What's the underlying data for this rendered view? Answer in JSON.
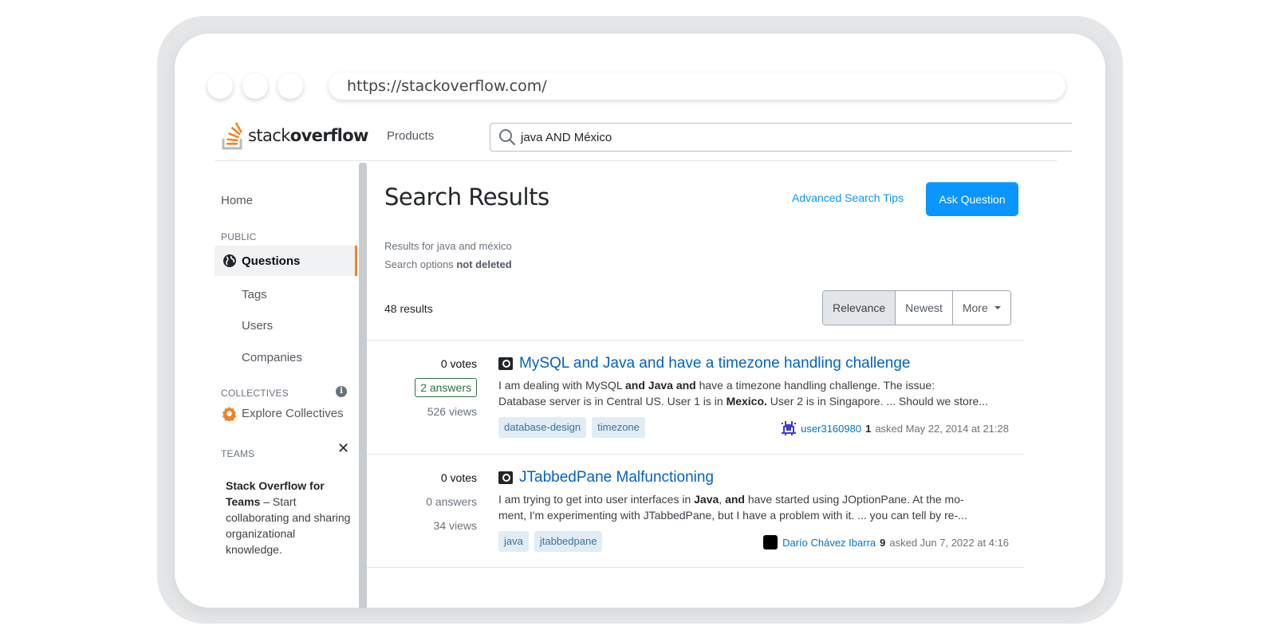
{
  "browser": {
    "url": "https://stackoverflow.com/"
  },
  "topbar": {
    "logo_text_light": "stack",
    "logo_text_bold": "overflow",
    "products_label": "Products",
    "search_value": "java AND México"
  },
  "sidebar": {
    "home": "Home",
    "public_label": "PUBLIC",
    "questions": "Questions",
    "tags": "Tags",
    "users": "Users",
    "companies": "Companies",
    "collectives_label": "COLLECTIVES",
    "explore_collectives": "Explore Collectives",
    "teams_label": "TEAMS",
    "teams_bold": "Stack Overflow for Teams",
    "teams_text": " – Start collaborating and sharing organizational knowledge."
  },
  "main": {
    "title": "Search Results",
    "advanced_tips": "Advanced Search Tips",
    "ask_button": "Ask Question",
    "results_for_prefix": "Results for ",
    "results_for_query": "java and méxico",
    "search_options_prefix": "Search options ",
    "search_options_value": "not deleted",
    "result_count": "48 results",
    "sort": {
      "relevance": "Relevance",
      "newest": "Newest",
      "more": "More"
    }
  },
  "results": [
    {
      "votes": "0 votes",
      "answers": "2 answers",
      "answers_accepted_style": true,
      "views": "526 views",
      "title": "MySQL and Java and have a timezone handling challenge",
      "excerpt_line1_parts": [
        "I am dealing with MySQL ",
        "and Java and",
        " have a timezone handling challenge. The issue:"
      ],
      "excerpt_line2_parts": [
        "Database server is in Central US. User 1 is in ",
        "Mexico.",
        " User 2 is in Singapore. ... Should we store..."
      ],
      "tags": [
        "database-design",
        "timezone"
      ],
      "user": "user3160980",
      "reputation": "1",
      "asked": "asked May 22, 2014 at 21:28"
    },
    {
      "votes": "0 votes",
      "answers": "0 answers",
      "answers_accepted_style": false,
      "views": "34 views",
      "title": "JTabbedPane Malfunctioning",
      "excerpt_line1_parts": [
        "I am trying to get into user interfaces in ",
        "Java",
        ", ",
        "and",
        " have started using JOptionPane. At the mo-"
      ],
      "excerpt_line2": "ment, I'm experimenting with JTabbedPane, but I have a problem with it. ... you can tell by re-...",
      "tags": [
        "java",
        "jtabbedpane"
      ],
      "user": "Darío Chávez Ibarra",
      "reputation": "9",
      "asked": "asked Jun 7, 2022 at 4:16"
    }
  ],
  "colors": {
    "accent_orange": "#f48225",
    "primary_blue": "#0a95ff",
    "link_blue": "#0063bf",
    "tag_bg": "#e1ecf4",
    "tag_fg": "#39739d",
    "accepted_green": "#2f6f44"
  },
  "icons": {
    "search": "search-icon",
    "globe": "globe-icon",
    "info": "info-icon",
    "collectives": "collectives-icon",
    "close": "close-icon",
    "question": "question-icon"
  }
}
